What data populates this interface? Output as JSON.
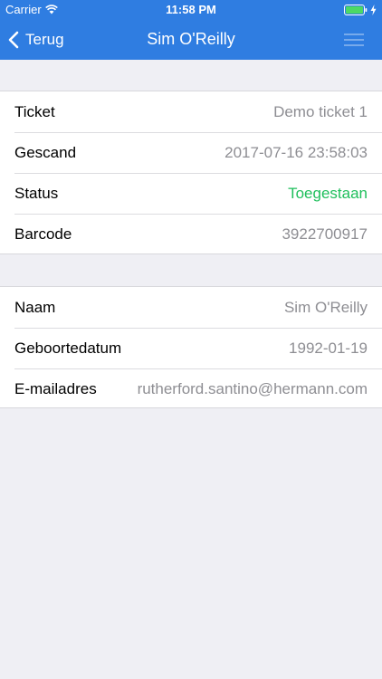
{
  "status_bar": {
    "carrier": "Carrier",
    "time": "11:58 PM",
    "wifi_icon": "wifi-icon",
    "battery_icon": "battery-icon",
    "charge_icon": "charging-bolt-icon"
  },
  "nav": {
    "back_label": "Terug",
    "back_icon": "chevron-left-icon",
    "title": "Sim O'Reilly",
    "menu_icon": "menu-icon",
    "background_color": "#2f7de1"
  },
  "ticket_group": {
    "rows": [
      {
        "label": "Ticket",
        "value": "Demo ticket 1"
      },
      {
        "label": "Gescand",
        "value": "2017-07-16 23:58:03"
      },
      {
        "label": "Status",
        "value": "Toegestaan",
        "value_color": "#1fbf5c"
      },
      {
        "label": "Barcode",
        "value": "3922700917"
      }
    ]
  },
  "person_group": {
    "rows": [
      {
        "label": "Naam",
        "value": "Sim O'Reilly"
      },
      {
        "label": "Geboortedatum",
        "value": "1992-01-19"
      },
      {
        "label": "E-mailadres",
        "value": "rutherford.santino@hermann.com"
      }
    ]
  }
}
